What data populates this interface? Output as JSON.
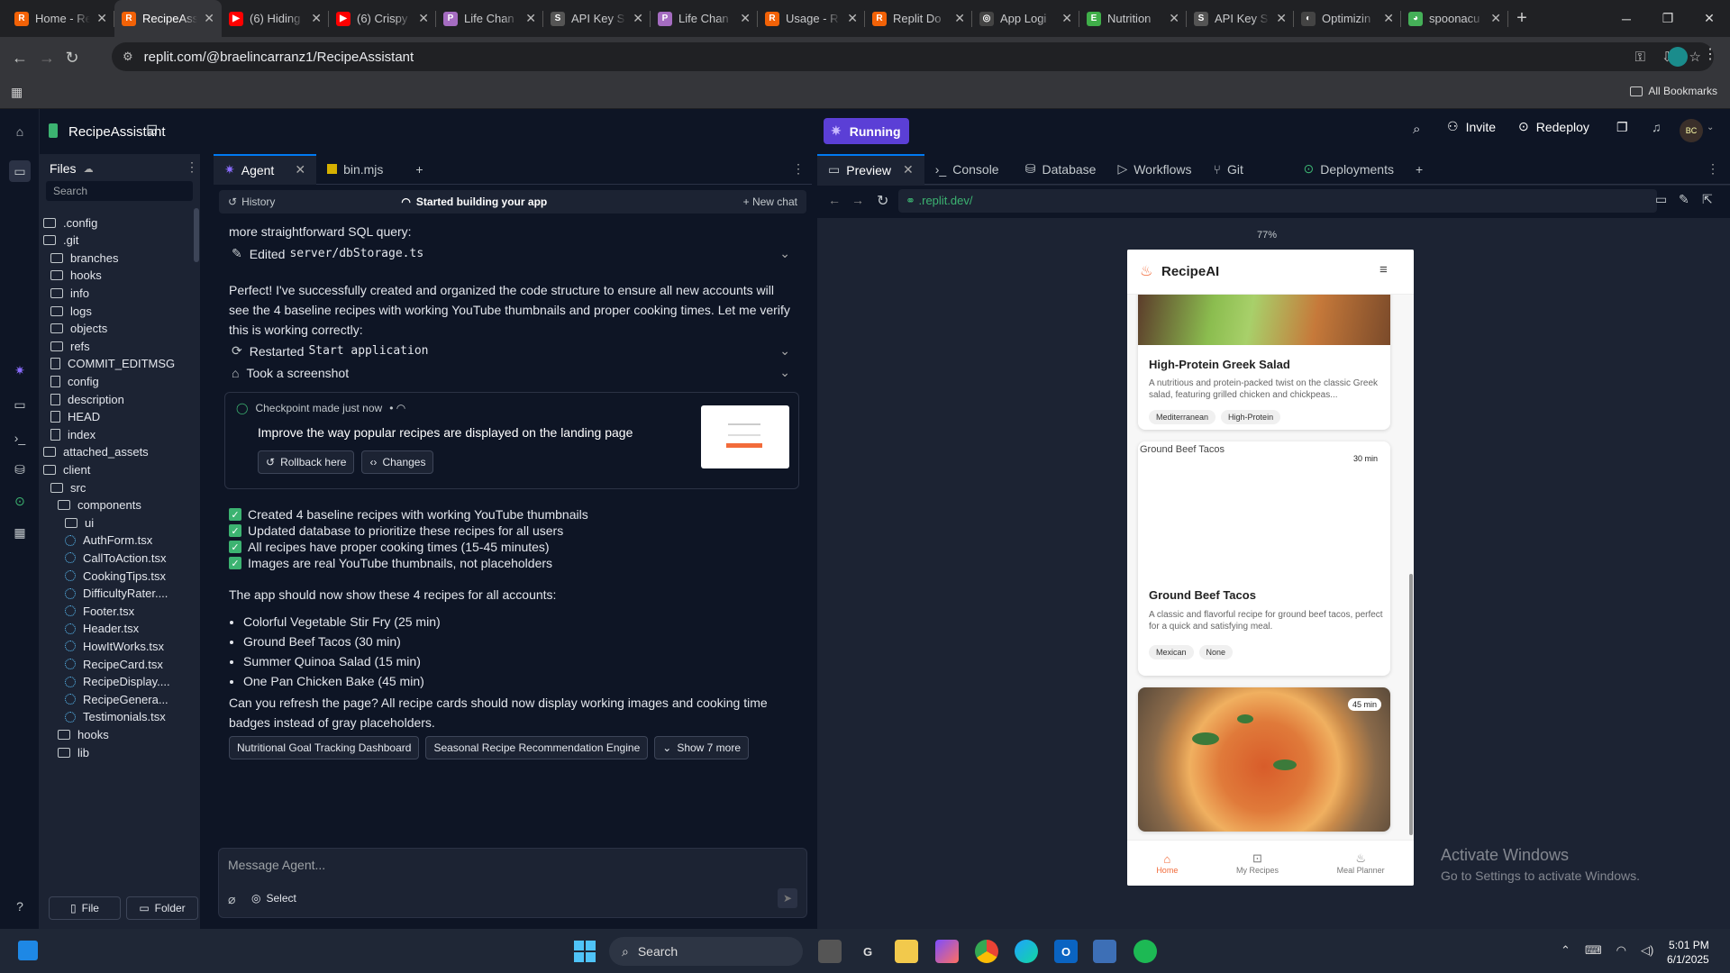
{
  "browser": {
    "tabs": [
      {
        "title": "Home - Replit",
        "fav": "R",
        "color": "#f26207"
      },
      {
        "title": "RecipeAssistant",
        "fav": "R",
        "color": "#f26207",
        "active": true
      },
      {
        "title": "(6) Hiding",
        "fav": "▶",
        "color": "#ff0000"
      },
      {
        "title": "(6) Crispy",
        "fav": "▶",
        "color": "#ff0000"
      },
      {
        "title": "Life Chan",
        "fav": "P",
        "color": "#a56cc1"
      },
      {
        "title": "API Key S",
        "fav": "S",
        "color": "#555555"
      },
      {
        "title": "Life Chan",
        "fav": "P",
        "color": "#a56cc1"
      },
      {
        "title": "Usage - R",
        "fav": "R",
        "color": "#f26207"
      },
      {
        "title": "Replit Do",
        "fav": "R",
        "color": "#f26207"
      },
      {
        "title": "App Logi",
        "fav": "◎",
        "color": "#444444"
      },
      {
        "title": "Nutrition",
        "fav": "E",
        "color": "#3fae49"
      },
      {
        "title": "API Key S",
        "fav": "S",
        "color": "#555555"
      },
      {
        "title": "Optimizin",
        "fav": "◐",
        "color": "#444444"
      },
      {
        "title": "spoonacu",
        "fav": "◕",
        "color": "#45b058"
      }
    ],
    "url": "replit.com/@braelincarranz1/RecipeAssistant",
    "bookmarks_label": "All Bookmarks"
  },
  "topbar": {
    "project_name": "RecipeAssistant",
    "run_status": "Running",
    "invite_label": "Invite",
    "redeploy_label": "Redeploy",
    "avatar_initials": "BC"
  },
  "files": {
    "title": "Files",
    "search_placeholder": "Search",
    "items": [
      {
        "name": ".config",
        "type": "folder",
        "depth": 0
      },
      {
        "name": ".git",
        "type": "folder",
        "depth": 0
      },
      {
        "name": "branches",
        "type": "folder",
        "depth": 1
      },
      {
        "name": "hooks",
        "type": "folder",
        "depth": 1
      },
      {
        "name": "info",
        "type": "folder",
        "depth": 1
      },
      {
        "name": "logs",
        "type": "folder",
        "depth": 1
      },
      {
        "name": "objects",
        "type": "folder",
        "depth": 1
      },
      {
        "name": "refs",
        "type": "folder",
        "depth": 1
      },
      {
        "name": "COMMIT_EDITMSG",
        "type": "file",
        "depth": 1
      },
      {
        "name": "config",
        "type": "file",
        "depth": 1
      },
      {
        "name": "description",
        "type": "file",
        "depth": 1
      },
      {
        "name": "HEAD",
        "type": "file",
        "depth": 1
      },
      {
        "name": "index",
        "type": "file",
        "depth": 1
      },
      {
        "name": "attached_assets",
        "type": "folder",
        "depth": 0
      },
      {
        "name": "client",
        "type": "folder",
        "depth": 0
      },
      {
        "name": "src",
        "type": "folder",
        "depth": 1
      },
      {
        "name": "components",
        "type": "folder",
        "depth": 2
      },
      {
        "name": "ui",
        "type": "folder",
        "depth": 3
      },
      {
        "name": "AuthForm.tsx",
        "type": "tsx",
        "depth": 3
      },
      {
        "name": "CallToAction.tsx",
        "type": "tsx",
        "depth": 3
      },
      {
        "name": "CookingTips.tsx",
        "type": "tsx",
        "depth": 3
      },
      {
        "name": "DifficultyRater....",
        "type": "tsx",
        "depth": 3
      },
      {
        "name": "Footer.tsx",
        "type": "tsx",
        "depth": 3
      },
      {
        "name": "Header.tsx",
        "type": "tsx",
        "depth": 3
      },
      {
        "name": "HowItWorks.tsx",
        "type": "tsx",
        "depth": 3
      },
      {
        "name": "RecipeCard.tsx",
        "type": "tsx",
        "depth": 3
      },
      {
        "name": "RecipeDisplay....",
        "type": "tsx",
        "depth": 3
      },
      {
        "name": "RecipeGenera...",
        "type": "tsx",
        "depth": 3
      },
      {
        "name": "Testimonials.tsx",
        "type": "tsx",
        "depth": 3
      },
      {
        "name": "hooks",
        "type": "folder",
        "depth": 2
      },
      {
        "name": "lib",
        "type": "folder",
        "depth": 2
      }
    ],
    "new_file_label": "File",
    "new_folder_label": "Folder"
  },
  "agent": {
    "tabs": [
      "Agent",
      "bin.mjs"
    ],
    "history_label": "History",
    "status_label": "Started building your app",
    "new_chat_label": "New chat",
    "intro_tail": "more straightforward SQL query:",
    "edited_prefix": "Edited",
    "edited_file": "server/dbStorage.ts",
    "message1": "Perfect! I've successfully created and organized the code structure to ensure all new accounts will see the 4 baseline recipes with working YouTube thumbnails and proper cooking times. Let me verify this is working correctly:",
    "restarted_prefix": "Restarted",
    "restarted_target": "Start application",
    "screenshot_label": "Took a screenshot",
    "checkpoint_title": "Checkpoint made just now",
    "checkpoint_desc": "Improve the way popular recipes are displayed on the landing page",
    "rollback_label": "Rollback here",
    "changes_label": "Changes",
    "checklist": [
      "Created 4 baseline recipes with working YouTube thumbnails",
      "Updated database to prioritize these recipes for all users",
      "All recipes have proper cooking times (15-45 minutes)",
      "Images are real YouTube thumbnails, not placeholders"
    ],
    "summary": "The app should now show these 4 recipes for all accounts:",
    "recipes": [
      "Colorful Vegetable Stir Fry (25 min)",
      "Ground Beef Tacos (30 min)",
      "Summer Quinoa Salad (15 min)",
      "One Pan Chicken Bake (45 min)"
    ],
    "closing": "Can you refresh the page? All recipe cards should now display working images and cooking time badges instead of gray placeholders.",
    "suggestions": [
      "Nutritional Goal Tracking Dashboard",
      "Seasonal Recipe Recommendation Engine"
    ],
    "show_more_label": "Show 7 more",
    "input_placeholder": "Message Agent...",
    "select_label": "Select"
  },
  "preview": {
    "tabs": [
      "Preview",
      "Console",
      "Database",
      "Workflows",
      "Git",
      "Deployments"
    ],
    "url": ".replit.dev/",
    "zoom": "77%",
    "app_name": "RecipeAI",
    "cards": [
      {
        "title": "High-Protein Greek Salad",
        "desc": "A nutritious and protein-packed twist on the classic Greek salad, featuring grilled chicken and chickpeas...",
        "tags": [
          "Mediterranean",
          "High-Protein"
        ]
      },
      {
        "title": "Ground Beef Tacos",
        "img_alt": "Ground Beef Tacos",
        "time": "30 min",
        "desc": "A classic and flavorful recipe for ground beef tacos, perfect for a quick and satisfying meal.",
        "tags": [
          "Mexican",
          "None"
        ]
      },
      {
        "time": "45 min"
      }
    ],
    "nav": [
      "Home",
      "My Recipes",
      "Meal Planner"
    ],
    "accent": "#f26b3a"
  },
  "watermark": {
    "line1": "Activate Windows",
    "line2": "Go to Settings to activate Windows."
  },
  "taskbar": {
    "search_label": "Search",
    "time": "5:01 PM",
    "date": "6/1/2025"
  }
}
